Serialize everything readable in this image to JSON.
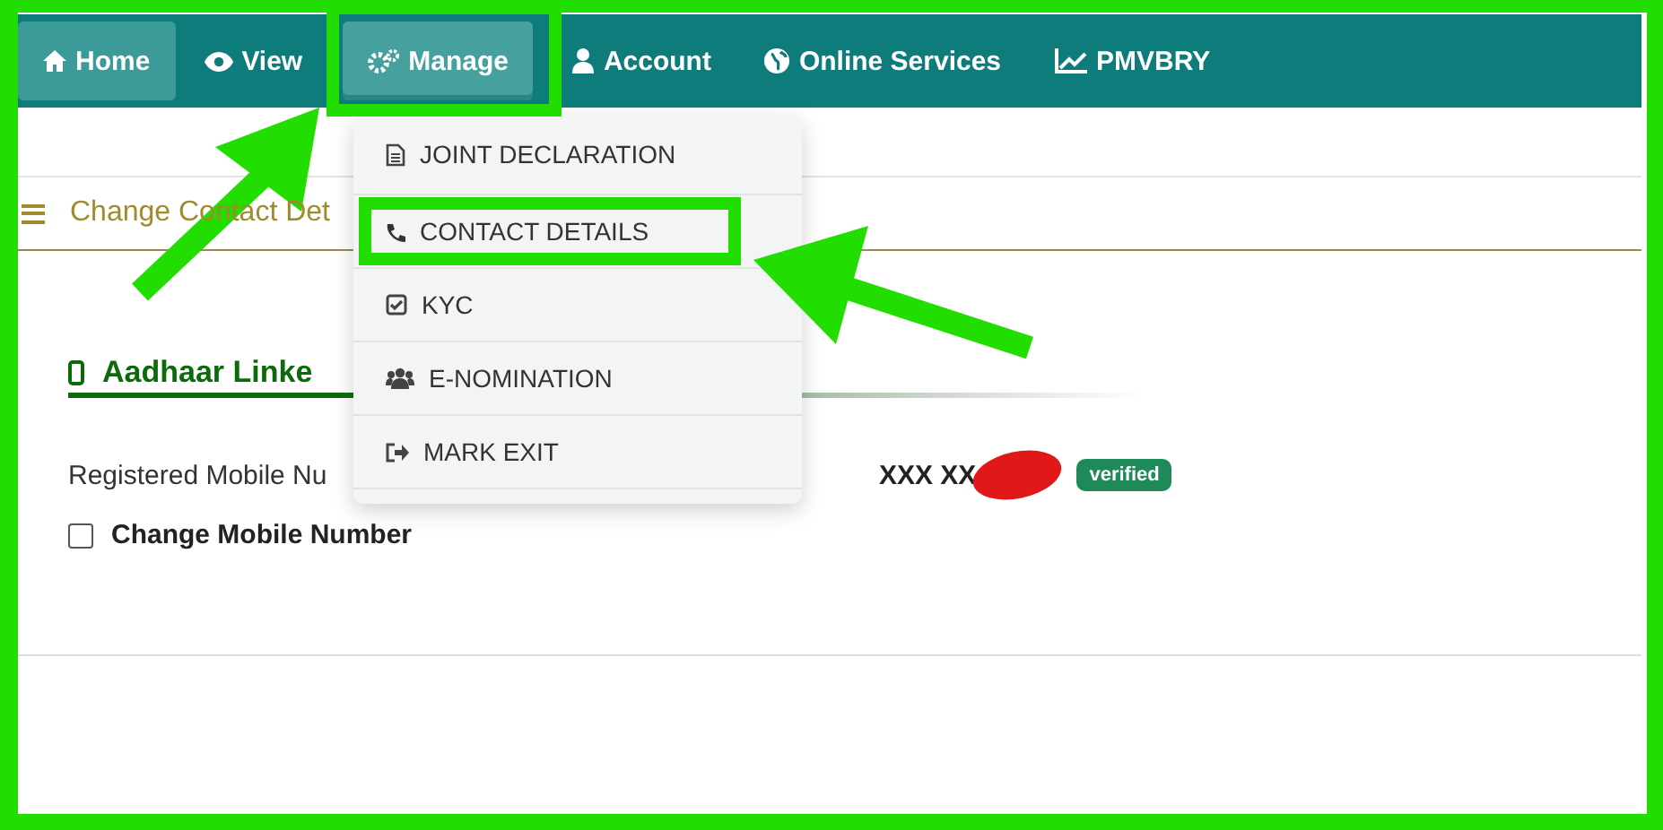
{
  "nav": [
    {
      "label": "Home",
      "selected": true,
      "expanded": false
    },
    {
      "label": "View",
      "selected": false,
      "expanded": false
    },
    {
      "label": "Manage",
      "selected": false,
      "expanded": true
    },
    {
      "label": "Account",
      "selected": false,
      "expanded": false
    },
    {
      "label": "Online Services",
      "selected": false,
      "expanded": false
    },
    {
      "label": "PMVBRY",
      "selected": false,
      "expanded": false
    }
  ],
  "menu": [
    {
      "label": "JOINT DECLARATION"
    },
    {
      "label": "CONTACT DETAILS"
    },
    {
      "label": "KYC"
    },
    {
      "label": "E-NOMINATION"
    },
    {
      "label": "MARK EXIT"
    }
  ],
  "breadcrumb": "Change Contact Det",
  "section": {
    "title": "Aadhaar Linke",
    "field_label": "Registered Mobile Nu",
    "value": "XXX XX",
    "badge": "verified",
    "option": {
      "label": "Change Mobile Number",
      "checked": false
    }
  }
}
